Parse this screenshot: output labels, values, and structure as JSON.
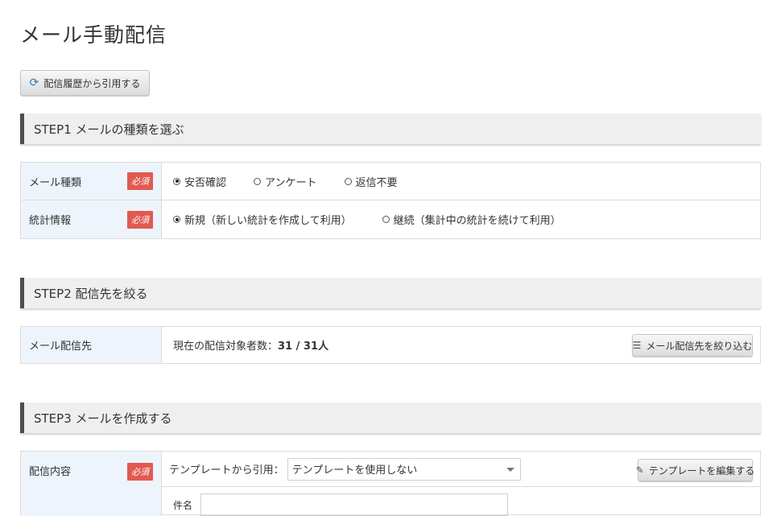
{
  "page": {
    "title": "メール手動配信"
  },
  "history_button": {
    "label": "配信履歴から引用する",
    "icon": "refresh-icon"
  },
  "step1": {
    "title": "STEP1 メールの種類を選ぶ",
    "rows": [
      {
        "label": "メール種類",
        "required": "必須",
        "options": [
          "安否確認",
          "アンケート",
          "返信不要"
        ],
        "selected": "安否確認"
      },
      {
        "label": "統計情報",
        "required": "必須",
        "options": [
          "新規（新しい統計を作成して利用）",
          "継続（集計中の統計を続けて利用）"
        ],
        "selected": "新規（新しい統計を作成して利用）"
      }
    ]
  },
  "step2": {
    "title": "STEP2 配信先を絞る",
    "row": {
      "label": "メール配信先",
      "count_prefix": "現在の配信対象者数：",
      "count_value": "31 / 31人",
      "filter_button": "メール配信先を絞り込む"
    }
  },
  "step3": {
    "title": "STEP3 メールを作成する",
    "row": {
      "label": "配信内容",
      "required": "必須",
      "template_label": "テンプレートから引用：",
      "template_selected": "テンプレートを使用しない",
      "edit_template_button": "テンプレートを編集する",
      "subject_label": "件名",
      "subject_value": ""
    }
  },
  "colors": {
    "required_badge": "#e05a52",
    "label_bg": "#edf4fb",
    "header_bg": "#efefef"
  }
}
